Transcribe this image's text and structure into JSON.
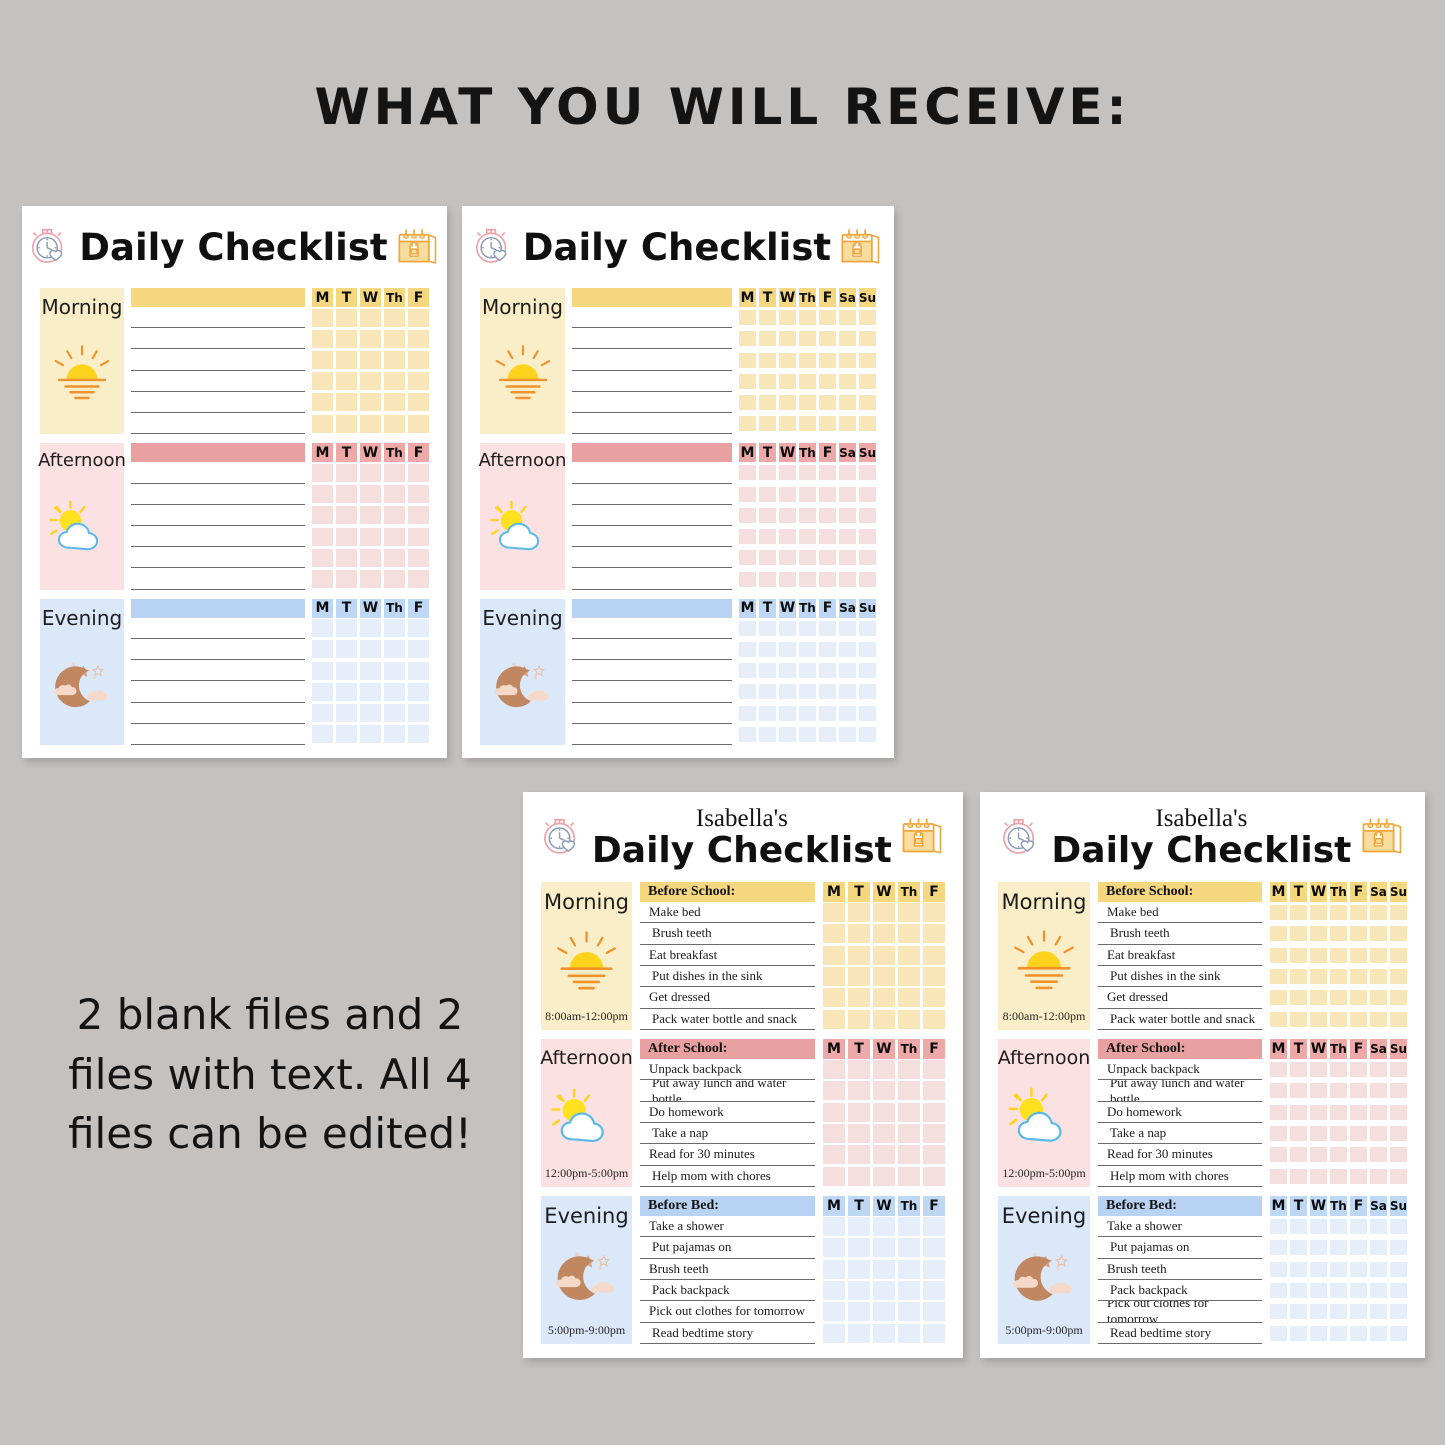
{
  "page": {
    "headline": "WHAT YOU WILL RECEIVE:",
    "blurb": "2 blank files and 2 files with text. All 4 files can be edited!",
    "background_color": "#c4c1bf"
  },
  "theme": {
    "morning": {
      "panel_bg": "#faeec8",
      "header_bar": "#f5d77f",
      "day_header": "#f5d77f",
      "check_cell": "#f9e6b8",
      "accent": "#e8952f"
    },
    "afternoon": {
      "panel_bg": "#fbe1e1",
      "header_bar": "#e8a0a0",
      "day_header": "#eda8a8",
      "check_cell": "#f5dede",
      "accent": "#d98f8f"
    },
    "evening": {
      "panel_bg": "#dbe8fa",
      "header_bar": "#b7d2f2",
      "day_header": "#bdd7f5",
      "check_cell": "#e6eefa",
      "accent": "#b9845f"
    }
  },
  "icons": {
    "stopwatch": "stopwatch-heart-icon",
    "calendar": "calendar-backpack-icon",
    "morning": "sunrise-icon",
    "afternoon": "sun-cloud-icon",
    "evening": "crescent-moon-icon"
  },
  "days_5": [
    "M",
    "T",
    "W",
    "Th",
    "F"
  ],
  "days_7": [
    "M",
    "T",
    "W",
    "Th",
    "F",
    "Sa",
    "Su"
  ],
  "cards": [
    {
      "id": "card-blank-5day",
      "owner": "",
      "title": "Daily Checklist",
      "days": [
        "M",
        "T",
        "W",
        "Th",
        "F"
      ],
      "periods": [
        {
          "name": "Morning",
          "time": "",
          "heading": "",
          "tasks": [
            "",
            "",
            "",
            "",
            "",
            ""
          ]
        },
        {
          "name": "Afternoon",
          "time": "",
          "heading": "",
          "tasks": [
            "",
            "",
            "",
            "",
            "",
            ""
          ]
        },
        {
          "name": "Evening",
          "time": "",
          "heading": "",
          "tasks": [
            "",
            "",
            "",
            "",
            "",
            ""
          ]
        }
      ]
    },
    {
      "id": "card-blank-7day",
      "owner": "",
      "title": "Daily Checklist",
      "days": [
        "M",
        "T",
        "W",
        "Th",
        "F",
        "Sa",
        "Su"
      ],
      "periods": [
        {
          "name": "Morning",
          "time": "",
          "heading": "",
          "tasks": [
            "",
            "",
            "",
            "",
            "",
            ""
          ]
        },
        {
          "name": "Afternoon",
          "time": "",
          "heading": "",
          "tasks": [
            "",
            "",
            "",
            "",
            "",
            ""
          ]
        },
        {
          "name": "Evening",
          "time": "",
          "heading": "",
          "tasks": [
            "",
            "",
            "",
            "",
            "",
            ""
          ]
        }
      ]
    },
    {
      "id": "card-filled-5day",
      "owner": "Isabella's",
      "title": "Daily Checklist",
      "days": [
        "M",
        "T",
        "W",
        "Th",
        "F"
      ],
      "periods": [
        {
          "name": "Morning",
          "time": "8:00am-12:00pm",
          "heading": "Before School:",
          "tasks": [
            "Make bed",
            "Brush teeth",
            "Eat breakfast",
            "Put dishes in the sink",
            "Get dressed",
            "Pack water bottle and snack"
          ]
        },
        {
          "name": "Afternoon",
          "time": "12:00pm-5:00pm",
          "heading": "After School:",
          "tasks": [
            "Unpack backpack",
            "Put away lunch and water bottle",
            "Do homework",
            "Take a nap",
            "Read for 30 minutes",
            "Help mom with chores"
          ]
        },
        {
          "name": "Evening",
          "time": "5:00pm-9:00pm",
          "heading": "Before Bed:",
          "tasks": [
            "Take a shower",
            "Put pajamas on",
            "Brush teeth",
            "Pack backpack",
            "Pick out clothes for tomorrow",
            "Read bedtime story"
          ]
        }
      ]
    },
    {
      "id": "card-filled-7day",
      "owner": "Isabella's",
      "title": "Daily Checklist",
      "days": [
        "M",
        "T",
        "W",
        "Th",
        "F",
        "Sa",
        "Su"
      ],
      "periods": [
        {
          "name": "Morning",
          "time": "8:00am-12:00pm",
          "heading": "Before School:",
          "tasks": [
            "Make bed",
            "Brush teeth",
            "Eat breakfast",
            "Put dishes in the sink",
            "Get dressed",
            "Pack water bottle and snack"
          ]
        },
        {
          "name": "Afternoon",
          "time": "12:00pm-5:00pm",
          "heading": "After School:",
          "tasks": [
            "Unpack backpack",
            "Put away lunch and water bottle",
            "Do homework",
            "Take a nap",
            "Read for 30 minutes",
            "Help mom with chores"
          ]
        },
        {
          "name": "Evening",
          "time": "5:00pm-9:00pm",
          "heading": "Before Bed:",
          "tasks": [
            "Take a shower",
            "Put pajamas on",
            "Brush teeth",
            "Pack backpack",
            "Pick out clothes for tomorrow",
            "Read bedtime story"
          ]
        }
      ]
    }
  ]
}
